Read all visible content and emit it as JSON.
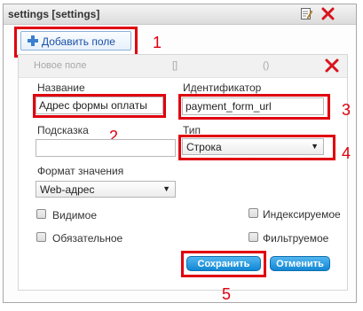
{
  "window": {
    "title": "settings [settings]"
  },
  "toolbar": {
    "add_field_label": "Добавить поле"
  },
  "field_panel": {
    "header_placeholder": "Новое поле",
    "header_brackets": "[]",
    "header_parens": "()"
  },
  "form": {
    "name_label": "Название",
    "name_value": "Адрес формы оплаты",
    "identifier_label": "Идентификатор",
    "identifier_value": "payment_form_url",
    "hint_label": "Подсказка",
    "hint_value": "",
    "type_label": "Тип",
    "type_value": "Строка",
    "format_label": "Формат значения",
    "format_value": "Web-адрес",
    "checkboxes": {
      "visible": "Видимое",
      "required": "Обязательное",
      "indexed": "Индексируемое",
      "filterable": "Фильтруемое"
    },
    "save_label": "Сохранить",
    "cancel_label": "Отменить"
  },
  "annotations": [
    "1",
    "2",
    "3",
    "4",
    "5"
  ],
  "colors": {
    "highlight": "#e0000f",
    "button": "#1187d5",
    "link": "#1a50a8"
  },
  "icons": {
    "edit": "edit-icon",
    "close": "close-icon",
    "add": "plus-icon",
    "remove": "remove-icon"
  }
}
